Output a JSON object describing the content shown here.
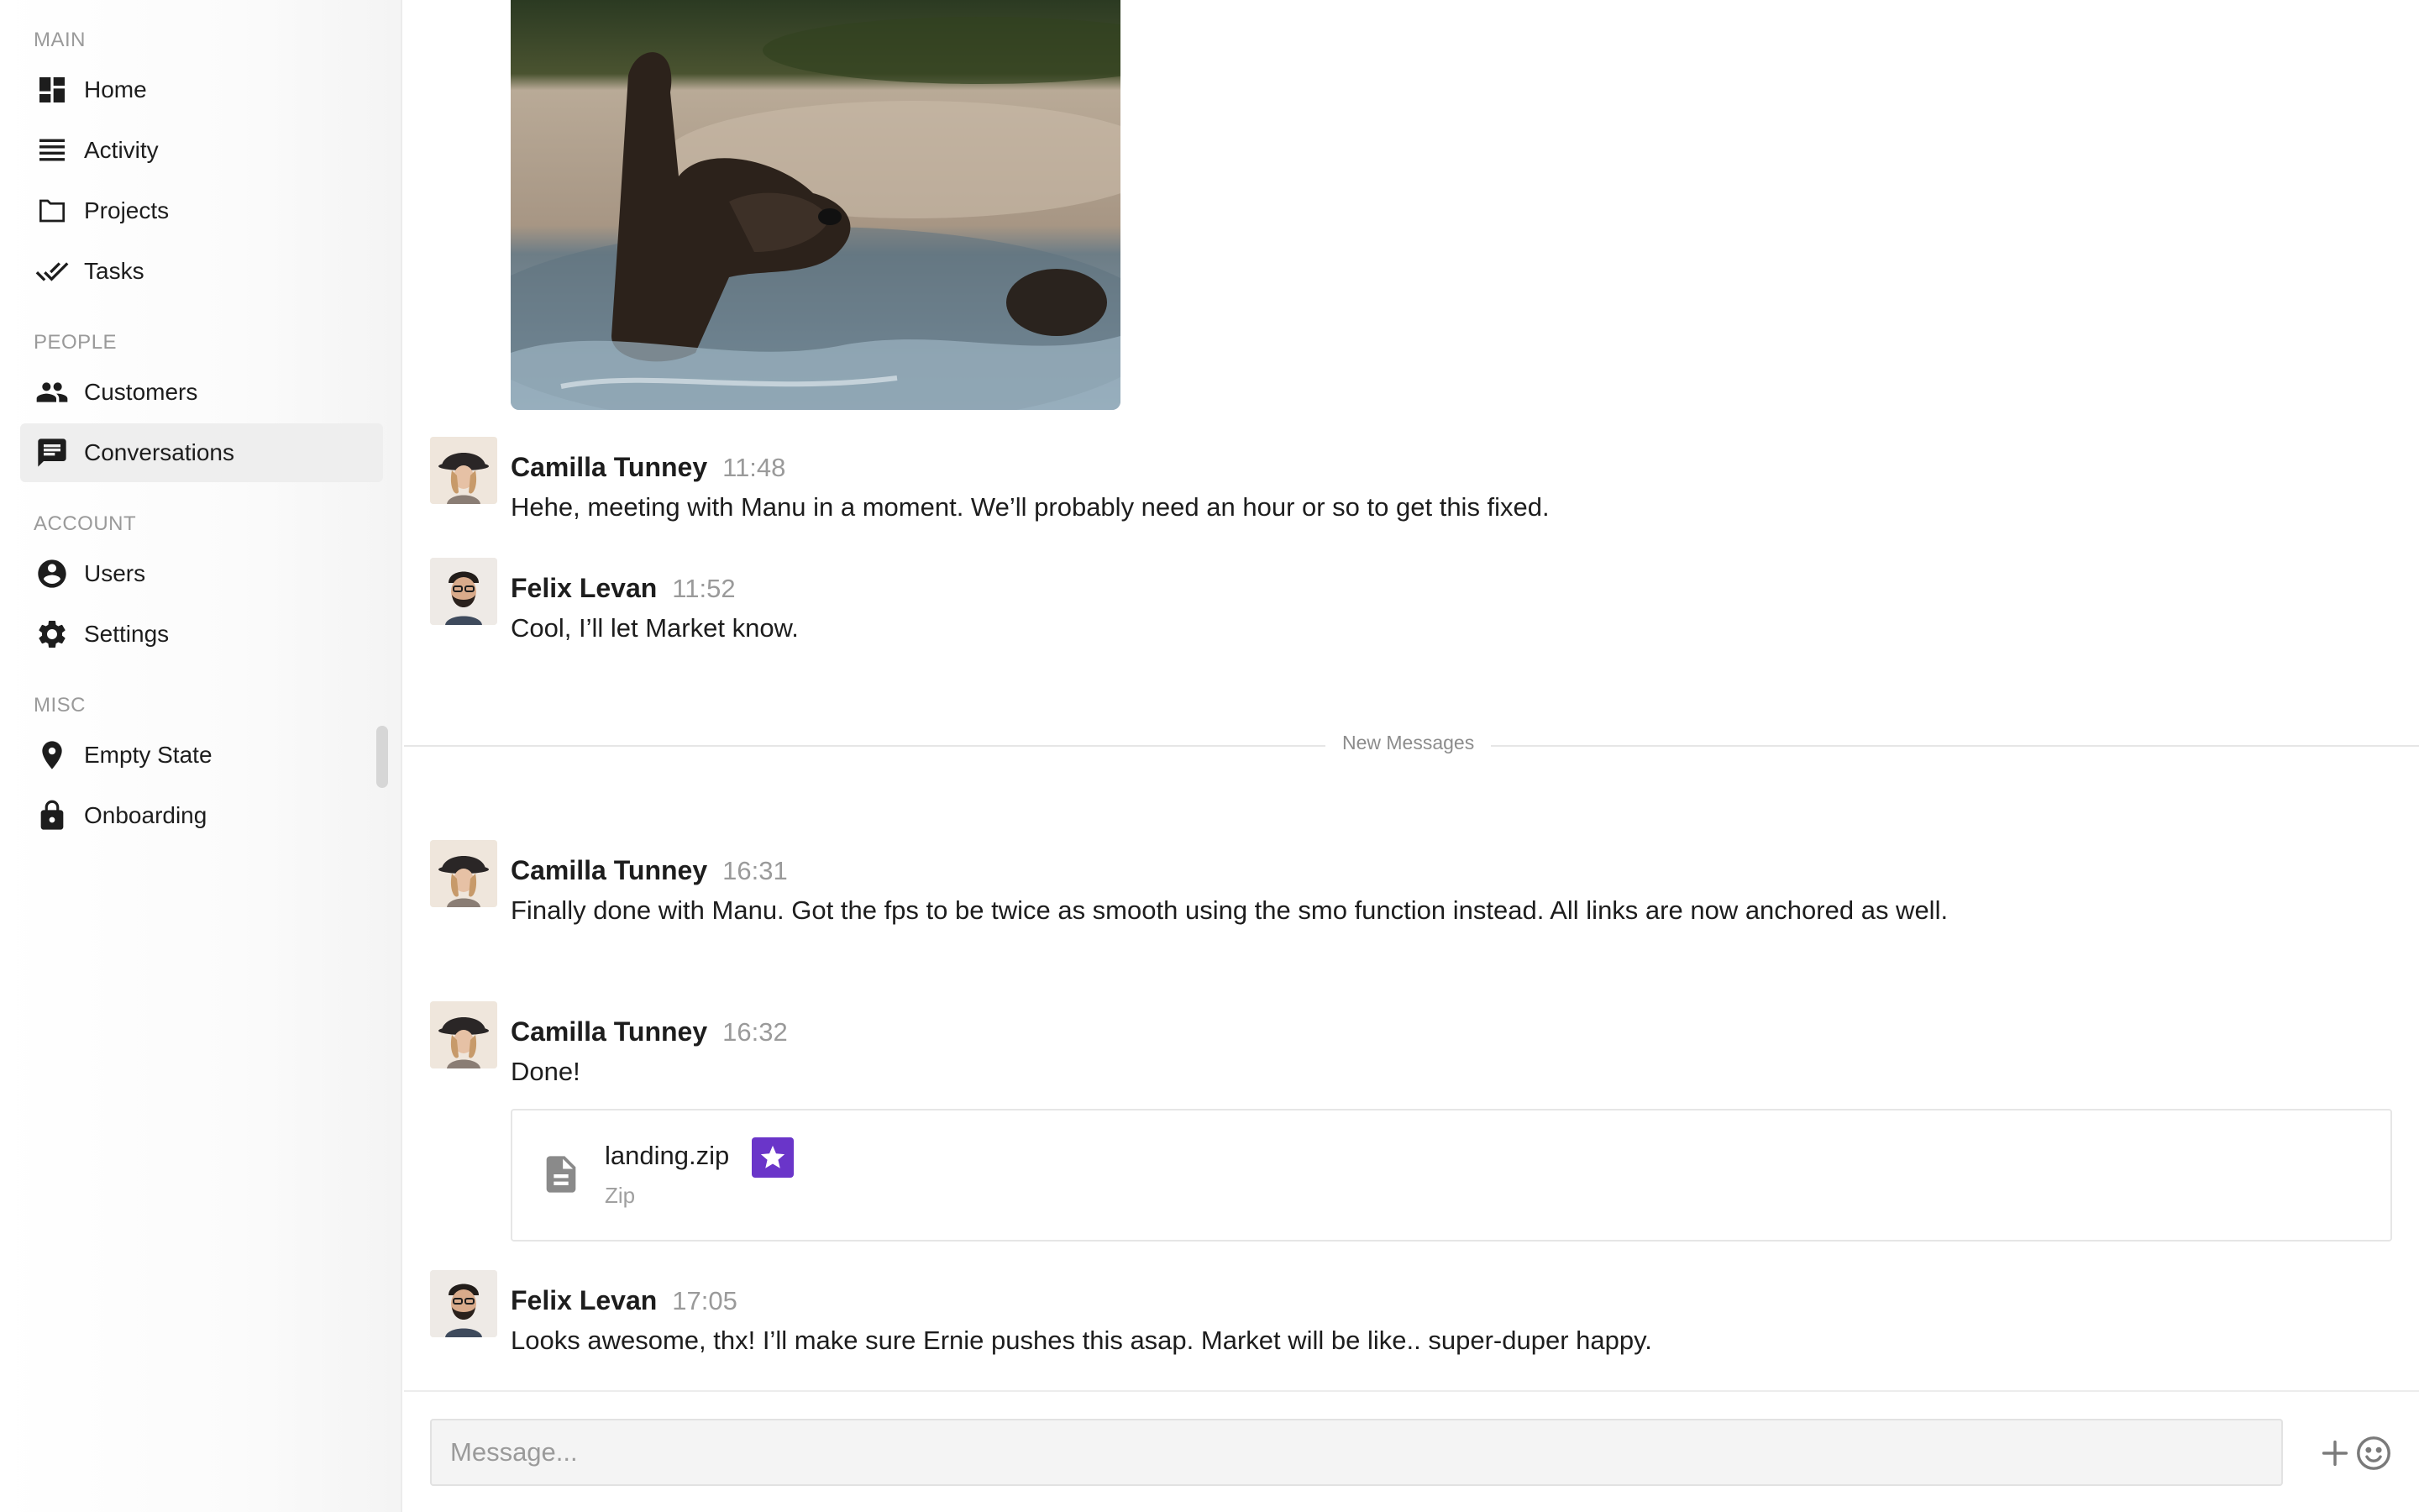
{
  "sidebar": {
    "sections": {
      "main": "MAIN",
      "people": "PEOPLE",
      "account": "ACCOUNT",
      "misc": "MISC"
    },
    "items": {
      "home": {
        "label": "Home",
        "icon": "dashboard-icon"
      },
      "activity": {
        "label": "Activity",
        "icon": "list-icon"
      },
      "projects": {
        "label": "Projects",
        "icon": "folder-icon"
      },
      "tasks": {
        "label": "Tasks",
        "icon": "double-check-icon"
      },
      "customers": {
        "label": "Customers",
        "icon": "people-icon"
      },
      "conversations": {
        "label": "Conversations",
        "icon": "chat-icon",
        "active": true
      },
      "users": {
        "label": "Users",
        "icon": "account-circle-icon"
      },
      "settings": {
        "label": "Settings",
        "icon": "gear-icon"
      },
      "empty_state": {
        "label": "Empty State",
        "icon": "location-pin-icon"
      },
      "onboarding": {
        "label": "Onboarding",
        "icon": "lock-icon"
      }
    }
  },
  "messages": [
    {
      "author": "Camilla Tunney",
      "time": "11:48",
      "text": "Hehe, meeting with Manu in a moment. We’ll probably need an hour or so to get this fixed."
    },
    {
      "author": "Felix Levan",
      "time": "11:52",
      "text": "Cool, I’ll let Market know."
    },
    {
      "author": "Camilla Tunney",
      "time": "16:31",
      "text": "Finally done with Manu. Got the fps to be twice as smooth using the smo function instead. All links are now anchored as well."
    },
    {
      "author": "Camilla Tunney",
      "time": "16:32",
      "text": "Done!"
    },
    {
      "author": "Felix Levan",
      "time": "17:05",
      "text": "Looks awesome, thx! I’ll make sure Ernie pushes this asap. Market will be like.. super-duper happy."
    }
  ],
  "divider": {
    "label": "New Messages"
  },
  "attachment": {
    "name": "landing.zip",
    "type": "Zip",
    "icon": "file-icon",
    "badge_icon": "star-icon",
    "badge_color": "#6a35c9"
  },
  "composer": {
    "placeholder": "Message..."
  },
  "colors": {
    "sidebar_active_bg": "#eeeeee",
    "muted_text": "#9a9a9a",
    "accent": "#6a35c9"
  }
}
